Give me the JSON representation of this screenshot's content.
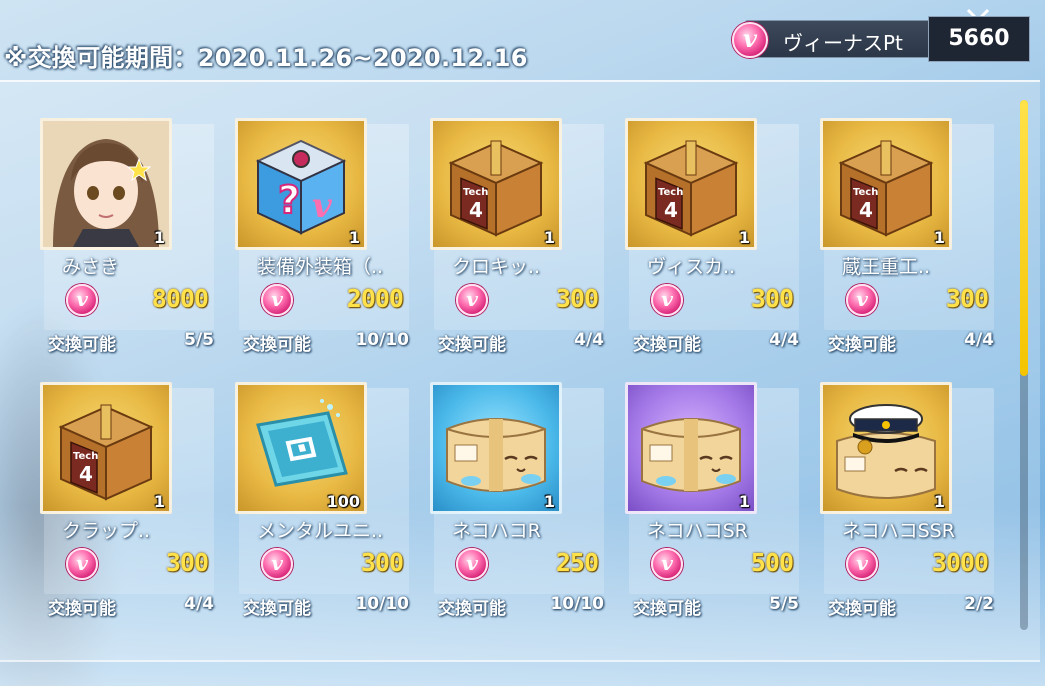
{
  "header": {
    "exchange_period": "※交換可能期間：2020.11.26~2020.12.16",
    "currency_label": "ヴィーナスPt",
    "currency_value": "5660",
    "currency_icon": "venus-point-coin-icon"
  },
  "colors": {
    "price_text": "#ffe14a",
    "scroll_thumb": "#f4c400",
    "coin_pink": "#d8267a"
  },
  "items": [
    {
      "name": "みさき",
      "qty": "1",
      "price": "8000",
      "status_label": "交換可能",
      "count": "5/5",
      "icon": "character-portrait-icon",
      "frame": "gold"
    },
    {
      "name": "装備外装箱（..",
      "qty": "1",
      "price": "2000",
      "status_label": "交換可能",
      "count": "10/10",
      "icon": "mystery-equipment-box-icon",
      "frame": "gold"
    },
    {
      "name": "クロキッ..",
      "qty": "1",
      "price": "300",
      "status_label": "交換可能",
      "count": "4/4",
      "icon": "tech4-crate-icon",
      "frame": "gold"
    },
    {
      "name": "ヴィスカ..",
      "qty": "1",
      "price": "300",
      "status_label": "交換可能",
      "count": "4/4",
      "icon": "tech4-crate-icon",
      "frame": "gold"
    },
    {
      "name": "蔵王重工..",
      "qty": "1",
      "price": "300",
      "status_label": "交換可能",
      "count": "4/4",
      "icon": "tech4-crate-icon",
      "frame": "gold"
    },
    {
      "name": "クラップ..",
      "qty": "1",
      "price": "300",
      "status_label": "交換可能",
      "count": "4/4",
      "icon": "tech4-crate-icon",
      "frame": "gold"
    },
    {
      "name": "メンタルユニ..",
      "qty": "100",
      "price": "300",
      "status_label": "交換可能",
      "count": "10/10",
      "icon": "mental-unit-chip-icon",
      "frame": "gold"
    },
    {
      "name": "ネコハコR",
      "qty": "1",
      "price": "250",
      "status_label": "交換可能",
      "count": "10/10",
      "icon": "cat-box-icon",
      "frame": "blue"
    },
    {
      "name": "ネコハコSR",
      "qty": "1",
      "price": "500",
      "status_label": "交換可能",
      "count": "5/5",
      "icon": "cat-box-icon",
      "frame": "purple"
    },
    {
      "name": "ネコハコSSR",
      "qty": "1",
      "price": "3000",
      "status_label": "交換可能",
      "count": "2/2",
      "icon": "cat-box-captain-hat-icon",
      "frame": "gold"
    }
  ]
}
